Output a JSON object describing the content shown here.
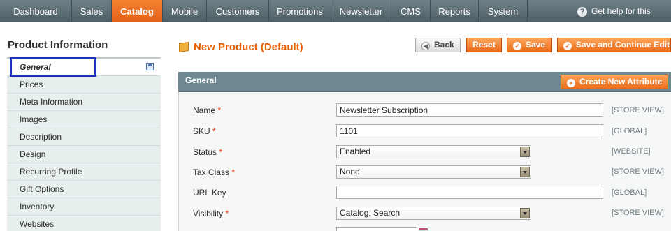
{
  "nav": {
    "items": [
      "Dashboard",
      "Sales",
      "Catalog",
      "Mobile",
      "Customers",
      "Promotions",
      "Newsletter",
      "CMS",
      "Reports",
      "System"
    ],
    "active": "Catalog",
    "help": "Get help for this page"
  },
  "sidebar": {
    "title": "Product Information",
    "items": [
      "General",
      "Prices",
      "Meta Information",
      "Images",
      "Description",
      "Design",
      "Recurring Profile",
      "Gift Options",
      "Inventory",
      "Websites"
    ],
    "active": "General"
  },
  "header": {
    "title": "New Product (Default)",
    "back_label": "Back",
    "reset_label": "Reset",
    "save_label": "Save",
    "save_continue_label": "Save and Continue Edit"
  },
  "section": {
    "title": "General",
    "create_attribute_label": "Create New Attribute"
  },
  "form": {
    "name": {
      "label": "Name",
      "value": "Newsletter Subscription",
      "scope": "[STORE VIEW]",
      "required": "*"
    },
    "sku": {
      "label": "SKU",
      "value": "1101",
      "scope": "[GLOBAL]",
      "required": "*"
    },
    "status": {
      "label": "Status",
      "value": "Enabled",
      "scope": "[WEBSITE]",
      "required": "*"
    },
    "tax_class": {
      "label": "Tax Class",
      "value": "None",
      "scope": "[STORE VIEW]",
      "required": "*"
    },
    "url_key": {
      "label": "URL Key",
      "value": "",
      "scope": "[GLOBAL]"
    },
    "visibility": {
      "label": "Visibility",
      "value": "Catalog, Search",
      "scope": "[STORE VIEW]",
      "required": "*"
    }
  },
  "colors": {
    "accent": "#eb5e00",
    "nav_bg": "#5f6f76",
    "section_bar": "#6f8992",
    "highlight_box": "#1c2fbf"
  }
}
